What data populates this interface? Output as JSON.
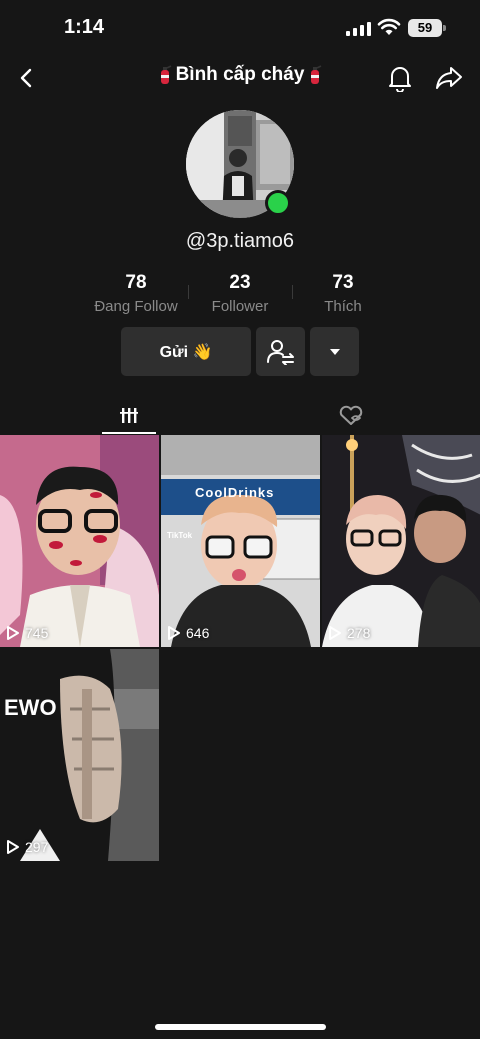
{
  "status": {
    "time": "1:14",
    "battery": "59"
  },
  "profile": {
    "title": "Bình cấp cháy",
    "username": "@3p.tiamo6",
    "online": true
  },
  "stats": [
    {
      "value": "78",
      "label": "Đang Follow"
    },
    {
      "value": "23",
      "label": "Follower"
    },
    {
      "value": "73",
      "label": "Thích"
    }
  ],
  "actions": {
    "send_label": "Gửi 👋"
  },
  "videos": [
    {
      "views": "745"
    },
    {
      "views": "646"
    },
    {
      "views": "278"
    },
    {
      "views": "297"
    }
  ],
  "thumb_text": {
    "sign": "CoolDrinks",
    "jacket": "EWO",
    "watermark": "TikTok"
  },
  "colors": {
    "background": "#161616",
    "button": "#2f2f2f",
    "online": "#2ad14a",
    "muted": "#8a8a8a"
  }
}
